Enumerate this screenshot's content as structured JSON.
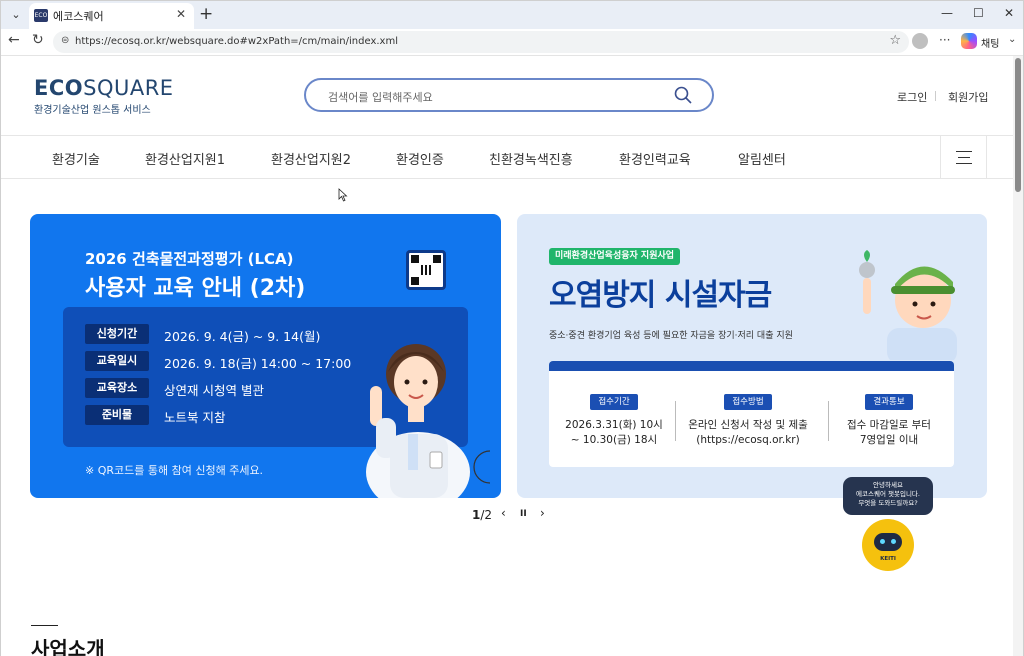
{
  "browser": {
    "tab_title": "에코스퀘어",
    "tab_favicon": "ECO",
    "url": "https://ecosq.or.kr/websquare.do#w2xPath=/cm/main/index.xml",
    "chat_label": "채팅",
    "new_tab": "+",
    "close": "✕",
    "minimize": "—",
    "maximize": "☐",
    "back": "←",
    "reload": "↻",
    "star": "☆",
    "more": "···",
    "dropdown": "⌄"
  },
  "header": {
    "logo_main_bold": "ECO",
    "logo_main_light": "SQUARE",
    "logo_sub": "환경기술산업 원스톱 서비스",
    "search_placeholder": "검색어를 입력해주세요",
    "login": "로그인",
    "signup": "회원가입"
  },
  "nav": {
    "items": [
      "환경기술",
      "환경산업지원1",
      "환경산업지원2",
      "환경인증",
      "친환경녹색진흥",
      "환경인력교육",
      "알림센터"
    ]
  },
  "banner1": {
    "title1": "2026 건축물전과정평가 (LCA)",
    "title2": "사용자 교육 안내 (2차)",
    "rows": [
      {
        "label": "신청기간",
        "value": "2026. 9. 4(금) ~ 9. 14(월)"
      },
      {
        "label": "교육일시",
        "value": "2026. 9. 18(금) 14:00 ~ 17:00"
      },
      {
        "label": "교육장소",
        "value": "상연재 시청역 별관"
      },
      {
        "label": "준비물",
        "value": "노트북 지참"
      }
    ],
    "note": "※ QR코드를 통해 참여 신청해 주세요."
  },
  "banner2": {
    "tag": "미래환경산업육성융자 지원사업",
    "title": "오염방지 시설자금",
    "subtitle": "중소·중견 환경기업 육성 등에 필요한 자금을 장기·저리 대출 지원",
    "cols": [
      {
        "label": "접수기간",
        "line1": "2026.3.31(화) 10시",
        "line2": "~ 10.30(금) 18시"
      },
      {
        "label": "접수방법",
        "line1": "온라인 신청서 작성 및 제출",
        "line2": "(https://ecosq.or.kr)"
      },
      {
        "label": "결과통보",
        "line1": "접수 마감일로 부터",
        "line2": "7영업일 이내"
      }
    ]
  },
  "pager": {
    "current": "1",
    "total": "/2",
    "prev": "‹",
    "pause": "II",
    "next": "›"
  },
  "chatbot": {
    "bubble": [
      "안녕하세요",
      "에코스퀘어 챗봇입니다.",
      "무엇을 도와드릴까요?"
    ],
    "name": "KEITI"
  },
  "section": {
    "title": "사업소개"
  }
}
